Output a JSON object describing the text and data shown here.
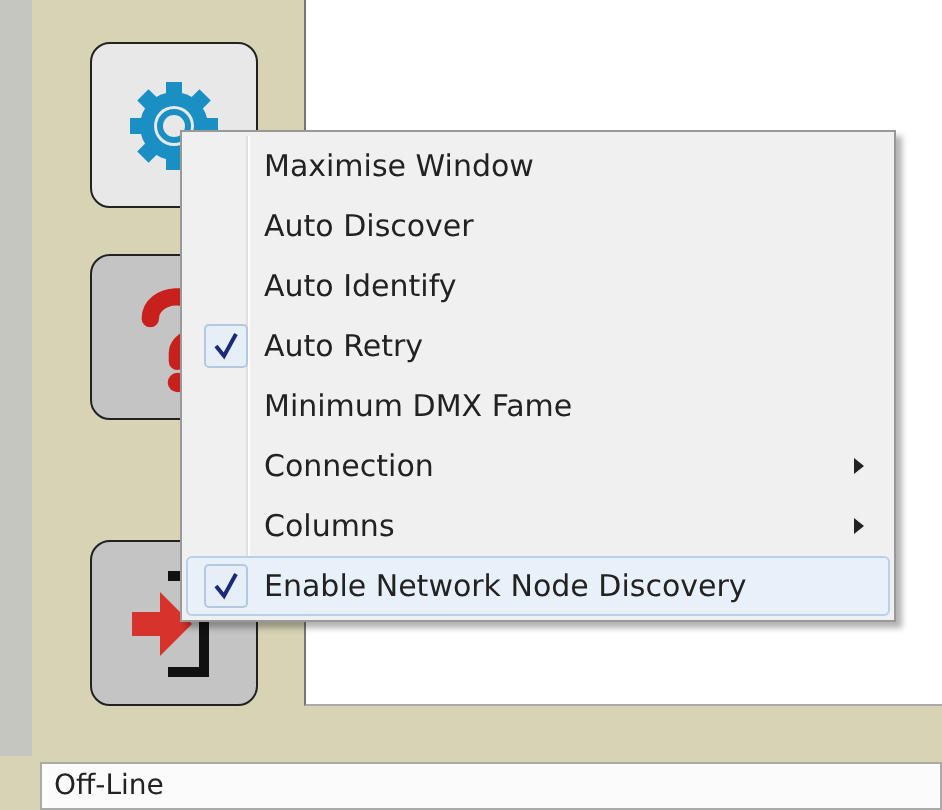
{
  "sidebar": {
    "buttons": [
      {
        "kind": "gear",
        "selected": true
      },
      {
        "kind": "help",
        "selected": false
      },
      {
        "kind": "exit",
        "selected": false
      }
    ]
  },
  "context_menu": {
    "items": [
      {
        "label": "Maximise Window",
        "kind": "command",
        "checked": false,
        "highlighted": false
      },
      {
        "label": "Auto Discover",
        "kind": "command",
        "checked": false,
        "highlighted": false
      },
      {
        "label": "Auto Identify",
        "kind": "command",
        "checked": false,
        "highlighted": false
      },
      {
        "label": "Auto Retry",
        "kind": "command",
        "checked": true,
        "highlighted": false
      },
      {
        "label": "Minimum DMX Fame",
        "kind": "command",
        "checked": false,
        "highlighted": false
      },
      {
        "label": "Connection",
        "kind": "submenu",
        "checked": false,
        "highlighted": false
      },
      {
        "label": "Columns",
        "kind": "submenu",
        "checked": false,
        "highlighted": false
      },
      {
        "label": "Enable Network Node Discovery",
        "kind": "command",
        "checked": true,
        "highlighted": true
      }
    ]
  },
  "status_bar": {
    "text": "Off-Line"
  }
}
